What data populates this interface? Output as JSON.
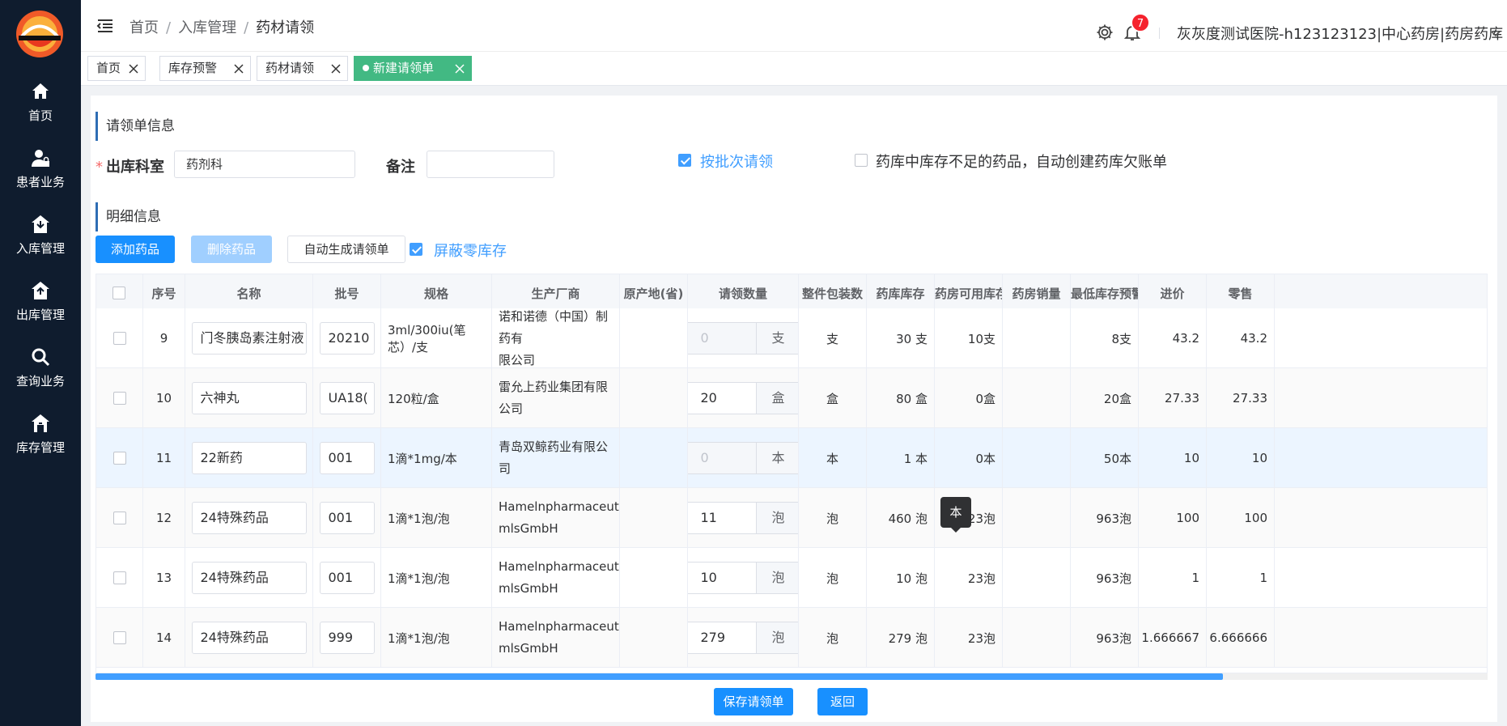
{
  "sidebar": {
    "items": [
      {
        "label": "首页",
        "icon": "home-icon"
      },
      {
        "label": "患者业务",
        "icon": "user-lock-icon"
      },
      {
        "label": "入库管理",
        "icon": "inbound-house-icon"
      },
      {
        "label": "出库管理",
        "icon": "outbound-house-icon"
      },
      {
        "label": "查询业务",
        "icon": "search-icon"
      },
      {
        "label": "库存管理",
        "icon": "warehouse-icon"
      }
    ]
  },
  "header": {
    "breadcrumb": [
      "首页",
      "入库管理",
      "药材请领"
    ],
    "breadcrumb_sep": "/",
    "notification_count": "7",
    "user_info": "灰灰度测试医院-h123123123|中心药房|药房药库"
  },
  "tabs": [
    {
      "label": "首页"
    },
    {
      "label": "库存预警"
    },
    {
      "label": "药材请领"
    },
    {
      "label": "新建请领单",
      "active": true
    }
  ],
  "form": {
    "section_title": "请领单信息",
    "dept_label": "出库科室",
    "required_mark": "*",
    "dept_value": "药剂科",
    "remark_label": "备注",
    "remark_value": "",
    "batch_label": "按批次请领",
    "batch_checked": true,
    "auto_owe_label": "药库中库存不足的药品，自动创建药库欠账单",
    "auto_owe_checked": false
  },
  "detail": {
    "section_title": "明细信息",
    "add_button": "添加药品",
    "delete_button": "删除药品",
    "auto_button": "自动生成请领单",
    "mask_label": "屏蔽零库存",
    "mask_checked": true
  },
  "table": {
    "columns": [
      "序号",
      "名称",
      "批号",
      "规格",
      "生产厂商",
      "原产地(省)",
      "请领数量",
      "整件包装数",
      "药库库存",
      "药房可用库存",
      "药房销量",
      "最低库存预警",
      "进价",
      "零售"
    ],
    "rows": [
      {
        "no": "9",
        "name": "门冬胰岛素注射液",
        "batch": "20210",
        "spec": "3ml/300iu(笔芯）/支",
        "maker": [
          "诺和诺德（中国）制药有",
          "限公司"
        ],
        "origin": "",
        "qty": "0",
        "qty_disabled": true,
        "unit": "支",
        "pack": "支",
        "stock": "30 支",
        "avail": "10支",
        "sales": "",
        "min": "8支",
        "price": "43.2",
        "retail": "43.2"
      },
      {
        "no": "10",
        "name": "六神丸",
        "batch": "UA18(",
        "spec": "120粒/盒",
        "maker": [
          "雷允上药业集团有限公司"
        ],
        "origin": "",
        "qty": "20",
        "qty_disabled": false,
        "unit": "盒",
        "pack": "盒",
        "stock": "80 盒",
        "avail": "0盒",
        "sales": "",
        "min": "20盒",
        "price": "27.33",
        "retail": "27.33"
      },
      {
        "no": "11",
        "name": "22新药",
        "batch": "001",
        "spec": "1滴*1mg/本",
        "maker": [
          "青岛双鲸药业有限公司"
        ],
        "origin": "",
        "qty": "0",
        "qty_disabled": true,
        "unit": "本",
        "pack": "本",
        "stock": "1 本",
        "avail": "0本",
        "sales": "",
        "min": "50本",
        "price": "10",
        "retail": "10"
      },
      {
        "no": "12",
        "name": "24特殊药品",
        "batch": "001",
        "spec": "1滴*1泡/泡",
        "maker": [
          "HamelnpharmaceuticalsG",
          "mlsGmbH"
        ],
        "origin": "",
        "qty": "11",
        "qty_disabled": false,
        "unit": "泡",
        "pack": "泡",
        "stock": "460 泡",
        "avail": "23泡",
        "sales": "",
        "min": "963泡",
        "price": "100",
        "retail": "100"
      },
      {
        "no": "13",
        "name": "24特殊药品",
        "batch": "001",
        "spec": "1滴*1泡/泡",
        "maker": [
          "HamelnpharmaceuticalsG",
          "mlsGmbH"
        ],
        "origin": "",
        "qty": "10",
        "qty_disabled": false,
        "unit": "泡",
        "pack": "泡",
        "stock": "10 泡",
        "avail": "23泡",
        "sales": "",
        "min": "963泡",
        "price": "1",
        "retail": "1"
      },
      {
        "no": "14",
        "name": "24特殊药品",
        "batch": "999",
        "spec": "1滴*1泡/泡",
        "maker": [
          "HamelnpharmaceuticalsG",
          "mlsGmbH"
        ],
        "origin": "",
        "qty": "279",
        "qty_disabled": false,
        "unit": "泡",
        "pack": "泡",
        "stock": "279 泡",
        "avail": "23泡",
        "sales": "",
        "min": "963泡",
        "price": "1.666667",
        "retail": "6.666666"
      }
    ],
    "highlight_row": 2,
    "scroll_fraction": 0.81
  },
  "tooltip": "本",
  "footer": {
    "save_button": "保存请领单",
    "back_button": "返回"
  },
  "colors": {
    "sidebar_bg": "#0f1c2e",
    "primary": "#1890ff",
    "active_tag": "#42b983",
    "badge": "#f5222d"
  }
}
